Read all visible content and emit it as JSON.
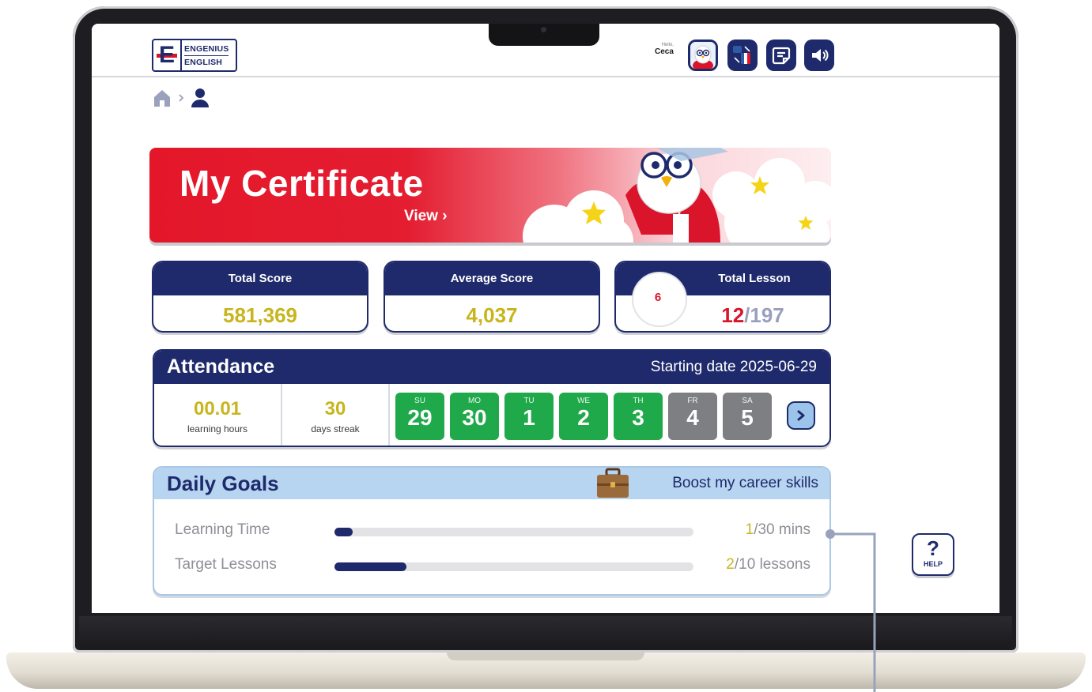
{
  "header": {
    "logo_line1": "ENGENIUS",
    "logo_line2": "ENGLISH",
    "logo_letter": "E",
    "user_greeting": "Hello,",
    "user_name": "Ceca",
    "icons": [
      "avatar-icon",
      "language-flag-icon",
      "notes-icon",
      "sound-icon"
    ]
  },
  "breadcrumb": {
    "icons": [
      "home-icon",
      "user-icon"
    ]
  },
  "certificate": {
    "title": "My Certificate",
    "view_label": "View ›"
  },
  "stats": {
    "total_score": {
      "label": "Total Score",
      "value": "581,369"
    },
    "average_score": {
      "label": "Average Score",
      "value": "4,037"
    },
    "total_lesson": {
      "label": "Total Lesson",
      "done": "12",
      "total": "/197",
      "ring_value": "6"
    }
  },
  "attendance": {
    "title": "Attendance",
    "starting_date": "Starting date 2025-06-29",
    "learning_hours": {
      "value": "00.01",
      "label": "learning hours"
    },
    "days_streak": {
      "value": "30",
      "label": "days streak"
    },
    "days": [
      {
        "name": "SU",
        "date": "29",
        "status": "attended"
      },
      {
        "name": "MO",
        "date": "30",
        "status": "attended"
      },
      {
        "name": "TU",
        "date": "1",
        "status": "attended"
      },
      {
        "name": "WE",
        "date": "2",
        "status": "attended"
      },
      {
        "name": "TH",
        "date": "3",
        "status": "attended"
      },
      {
        "name": "FR",
        "date": "4",
        "status": "upcoming"
      },
      {
        "name": "SA",
        "date": "5",
        "status": "upcoming"
      }
    ]
  },
  "daily_goals": {
    "title": "Daily Goals",
    "goal": "Boost my career skills",
    "rows": [
      {
        "label": "Learning Time",
        "current": "1",
        "target": "/30 mins",
        "progress": 0.033
      },
      {
        "label": "Target Lessons",
        "current": "2",
        "target": "/10 lessons",
        "progress": 0.2
      }
    ]
  },
  "help": {
    "label": "HELP",
    "symbol": "?"
  },
  "colors": {
    "navy": "#1e2a6b",
    "red": "#d9142b",
    "gold": "#c8b51c",
    "green": "#20a94a",
    "grey": "#7d7f83",
    "light_blue": "#b7d5f1"
  }
}
